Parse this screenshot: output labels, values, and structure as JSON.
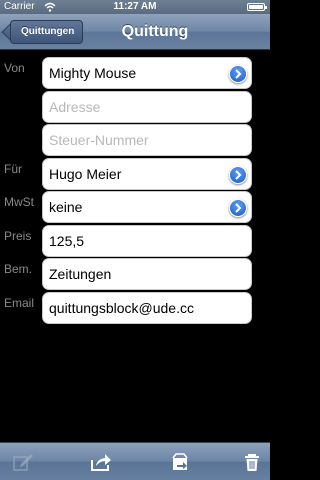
{
  "status_bar": {
    "carrier": "Carrier",
    "time": "11:27 AM"
  },
  "nav": {
    "back_label": "Quittungen",
    "title": "Quittung"
  },
  "form": {
    "von_label": "Von",
    "von_value": "Mighty Mouse",
    "adresse_placeholder": "Adresse",
    "steuer_placeholder": "Steuer-Nummer",
    "fuer_label": "Für",
    "fuer_value": "Hugo Meier",
    "mwst_label": "MwSt",
    "mwst_value": "keine",
    "preis_label": "Preis",
    "preis_value": "125,5",
    "bem_label": "Bem.",
    "bem_value": "Zeitungen",
    "email_label": "Email",
    "email_value": "quittungsblock@ude.cc"
  },
  "toolbar": {
    "items": [
      "compose-icon",
      "share-icon",
      "export-icon",
      "trash-icon"
    ],
    "compose_enabled": false
  },
  "colors": {
    "accent": "#1e5dc7",
    "navbar": "#6e86a6",
    "label": "#8a8a8a",
    "placeholder": "#b8b8b8"
  }
}
